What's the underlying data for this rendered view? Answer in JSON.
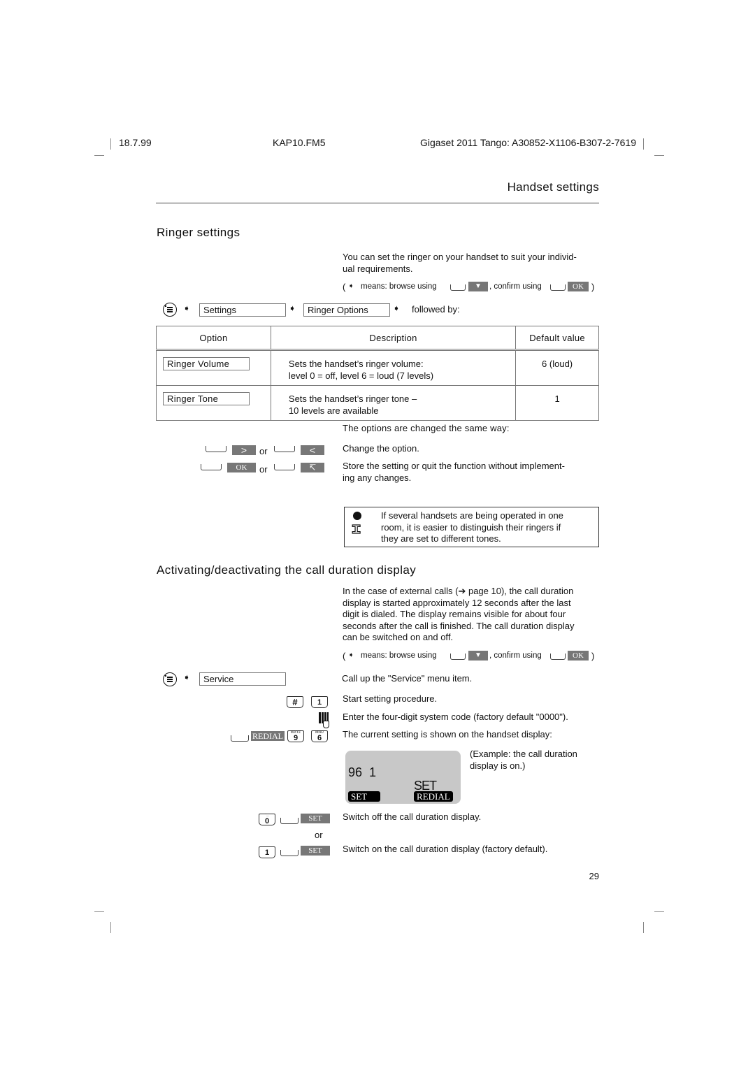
{
  "header": {
    "date": "18.7.99",
    "file": "KAP10.FM5",
    "product": "Gigaset 2011 Tango: A30852-X1106-B307-2-7619"
  },
  "chapter_title": "Handset settings",
  "section1": {
    "title": "Ringer settings",
    "intro": "You can set the ringer on your handset to suit your individ-ual requirements.",
    "intro_line1": "You can set the ringer on your handset to suit your individ-",
    "intro_line2": "ual requirements.",
    "browse_hint": {
      "open": "(",
      "means": "means: browse using",
      "browse_key": "▼",
      "confirm": ", confirm using",
      "confirm_key": "OK",
      "close": ")"
    },
    "menu_path": {
      "step1": "Settings",
      "step2": "Ringer Options",
      "suffix": "followed by:"
    },
    "table": {
      "headers": [
        "Option",
        "Description",
        "Default value"
      ],
      "rows": [
        {
          "option": "Ringer Volume",
          "desc1": "Sets the handset’s ringer volume:",
          "desc2": "level 0 = off, level 6 = loud (7 levels)",
          "default": "6 (loud)"
        },
        {
          "option": "Ringer Tone",
          "desc1": "Sets the handset’s ringer tone –",
          "desc2": "10 levels are available",
          "default": "1"
        }
      ]
    },
    "same_way": "The options are changed the same way:",
    "steps": [
      {
        "key_a": ">",
        "or": "or",
        "key_b": "<",
        "text1": "Change the option.",
        "text2": ""
      },
      {
        "key_a": "OK",
        "or": "or",
        "key_b": "↸",
        "text1": "Store the setting or quit the function without implement-",
        "text2": "ing any changes."
      }
    ],
    "note": {
      "line1": "If several handsets are being operated in one",
      "line2": "room, it is easier to distinguish their ringers if",
      "line3": "they are set to different tones."
    }
  },
  "section2": {
    "title": "Activating/deactivating the call duration display",
    "intro_lines": [
      "In the case of external calls (➔ page 10), the call duration",
      "display is started approximately 12 seconds after the last",
      "digit is dialed. The display remains visible for about four",
      "seconds after the call is finished. The call duration display",
      "can be switched on and off."
    ],
    "browse_hint": {
      "open": "(",
      "means": "means: browse using",
      "browse_key": "▼",
      "confirm": ", confirm using",
      "confirm_key": "OK",
      "close": ")"
    },
    "menu_step": "Service",
    "step_service": "Call up the \"Service\" menu item.",
    "keys": {
      "hash": "#",
      "one": "1",
      "nine": "9",
      "nine_letters": "WXYZ",
      "six": "6",
      "six_letters": "MNO",
      "zero": "0",
      "redial": "REDIAL",
      "set": "SET"
    },
    "step_start": "Start setting procedure.",
    "step_code": "Enter the four-digit system code (factory default \"0000\").",
    "step_current": "The current setting is shown on the handset display:",
    "lcd": {
      "line1": "96  1",
      "line2": "SET",
      "left_key": "SET",
      "right_key": "REDIAL"
    },
    "example_line1": "(Example: the call duration",
    "example_line2": "display is on.)",
    "step_off": "Switch off the call duration display.",
    "or": "or",
    "step_on": "Switch on the call duration display (factory default)."
  },
  "page_number": "29"
}
